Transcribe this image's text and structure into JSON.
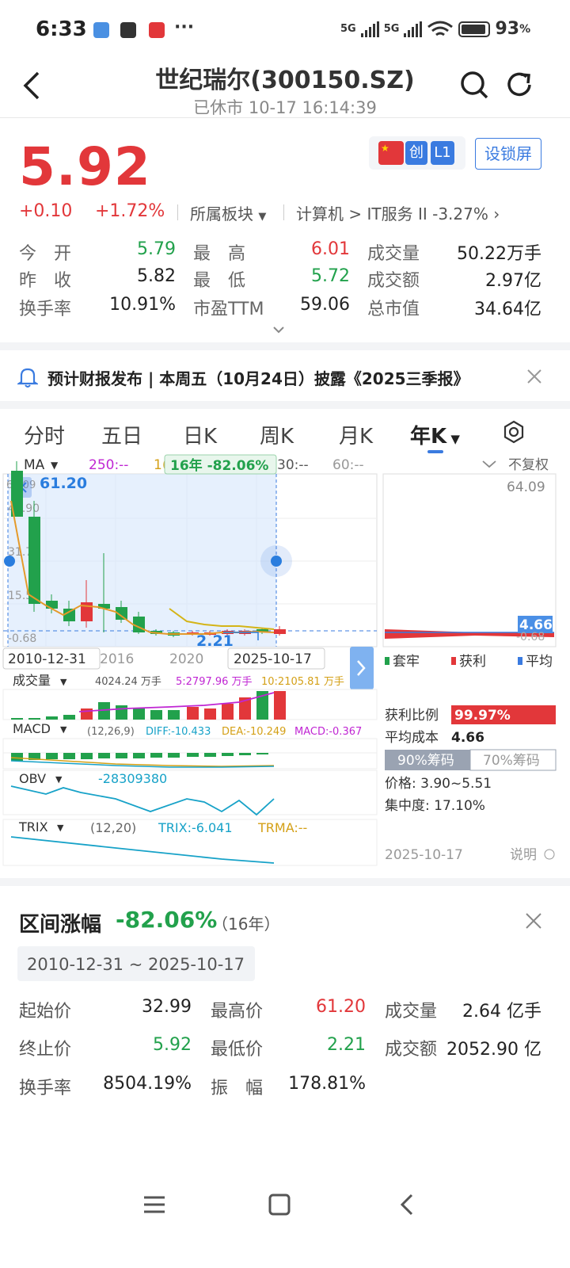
{
  "status_bar": {
    "time": "6:33",
    "signal1": "5G",
    "signal2": "5G",
    "battery": "93",
    "battery_unit": "%",
    "dots": "···"
  },
  "header": {
    "title": "世纪瑞尔(300150.SZ)",
    "subtitle": "已休市 10-17 16:14:39"
  },
  "quote": {
    "price": "5.92",
    "change": "+0.10",
    "change_pct": "+1.72%",
    "sector_label": "所属板块",
    "sector_path": "计算机 > IT服务 II",
    "sector_pct": "-3.27%",
    "tag_chuang": "创",
    "tag_l1": "L1",
    "lock_button": "设锁屏",
    "stats": [
      {
        "label": "今　开",
        "value": "5.79",
        "color": "green"
      },
      {
        "label": "最　高",
        "value": "6.01",
        "color": "red"
      },
      {
        "label": "成交量",
        "value": "50.22万手",
        "color": "black"
      },
      {
        "label": "昨　收",
        "value": "5.82",
        "color": "black"
      },
      {
        "label": "最　低",
        "value": "5.72",
        "color": "green"
      },
      {
        "label": "成交额",
        "value": "2.97亿",
        "color": "black"
      },
      {
        "label": "换手率",
        "value": "10.91%",
        "color": "black"
      },
      {
        "label": "市盈TTM",
        "value": "59.06",
        "color": "black"
      },
      {
        "label": "总市值",
        "value": "34.64亿",
        "color": "black"
      }
    ]
  },
  "notice": {
    "text": "预计财报发布 | 本周五（10月24日）披露《2025三季报》"
  },
  "tabs": [
    "分时",
    "五日",
    "日K",
    "周K",
    "月K",
    "年K"
  ],
  "chart": {
    "ma_label": "MA",
    "ma250": "250:--",
    "ma10_prefix": "1(",
    "range_badge": "16年 -82.06%",
    "ma30": "30:--",
    "ma60": "60:--",
    "adj": "不复权",
    "y_high": "61.20",
    "y_ticks": [
      "64.09",
      "47.90",
      "31.71",
      "15.51",
      "-0.68"
    ],
    "low_label": "2.21",
    "x_labels": [
      "2010-12-31",
      "2016",
      "2020",
      "2025-10-17"
    ],
    "vol_label": "成交量",
    "vol_value": "4024.24 万手",
    "vol5": "5:2797.96 万手",
    "vol10": "10:2105.81 万手",
    "macd_label": "MACD",
    "macd_params": "(12,26,9)",
    "diff": "DIFF:-10.433",
    "dea": "DEA:-10.249",
    "macd": "MACD:-0.367",
    "obv_label": "OBV",
    "obv_value": "-28309380",
    "trix_label": "TRIX",
    "trix_params": "(12,20)",
    "trix": "TRIX:-6.041",
    "trma": "TRMA:--"
  },
  "chip": {
    "top": "64.09",
    "avg_badge": "4.66",
    "low": "-0.68",
    "legend": [
      "套牢",
      "获利",
      "平均"
    ],
    "profit_label": "获利比例",
    "profit_value": "99.97%",
    "avg_label": "平均成本",
    "avg_value": "4.66",
    "tab90": "90%筹码",
    "tab70": "70%筹码",
    "price_range": "价格: 3.90~5.51",
    "concentration": "集中度: 17.10%",
    "date": "2025-10-17",
    "explain": "说明"
  },
  "interval": {
    "title": "区间涨幅",
    "pct": "-82.06%",
    "years": "（16年）",
    "range": "2010-12-31 ~ 2025-10-17",
    "rows": [
      {
        "label": "起始价",
        "value": "32.99",
        "color": "black"
      },
      {
        "label": "最高价",
        "value": "61.20",
        "color": "red"
      },
      {
        "label": "成交量",
        "value": "2.64 亿手",
        "color": "black"
      },
      {
        "label": "终止价",
        "value": "5.92",
        "color": "green"
      },
      {
        "label": "最低价",
        "value": "2.21",
        "color": "green"
      },
      {
        "label": "成交额",
        "value": "2052.90 亿",
        "color": "black"
      },
      {
        "label": "换手率",
        "value": "8504.19%",
        "color": "black"
      },
      {
        "label": "振　幅",
        "value": "178.81%",
        "color": "black"
      }
    ]
  },
  "colors": {
    "red": "#e2373a",
    "green": "#22a14c",
    "blue": "#3a7be0"
  }
}
